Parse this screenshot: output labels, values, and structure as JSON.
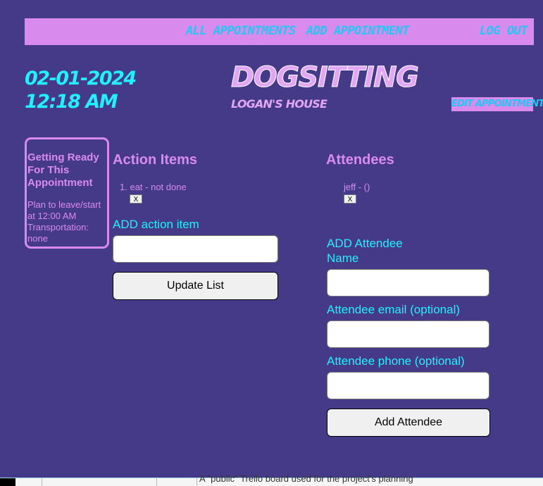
{
  "nav": {
    "all_appointments": "ALL APPOINTMENTS",
    "add_appointment": "ADD APPOINTMENT",
    "log_out": "LOG OUT"
  },
  "appointment": {
    "date": "02-01-2024",
    "time": "12:18 AM",
    "title": "DOGSITTING",
    "location": "LOGAN'S HOUSE",
    "edit_label": "EDIT APPOINTMENT"
  },
  "getting_ready": {
    "title": "Getting Ready For This Appointment",
    "plan": "Plan to leave/start at 12:00 AM",
    "transportation": "Transportation: none"
  },
  "action_items": {
    "heading": "Action Items",
    "items": [
      {
        "number": "1.",
        "text": "eat - not done",
        "remove_label": "X"
      }
    ],
    "add_label": "ADD action item",
    "input_value": "",
    "update_button": "Update List"
  },
  "attendees": {
    "heading": "Attendees",
    "items": [
      {
        "text": "jeff - ()",
        "remove_label": "X"
      }
    ],
    "add_heading": "ADD Attendee",
    "name_label": "Name",
    "email_label": "Attendee email (optional)",
    "phone_label": "Attendee phone (optional)",
    "add_button": "Add Attendee"
  },
  "background_text": "A \"public\" Trello board used for the project's planning"
}
